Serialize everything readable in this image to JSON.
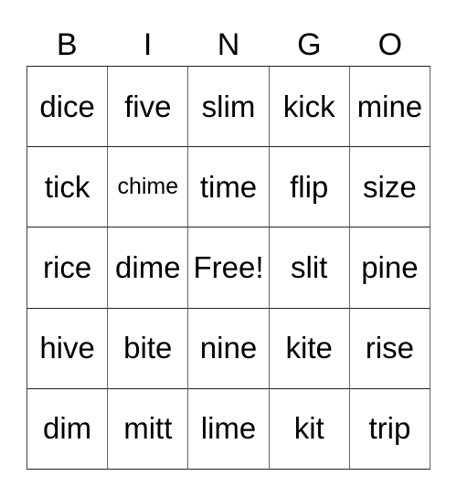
{
  "header": [
    "B",
    "I",
    "N",
    "G",
    "O"
  ],
  "rows": [
    [
      "dice",
      "five",
      "slim",
      "kick",
      "mine"
    ],
    [
      "tick",
      "chime",
      "time",
      "flip",
      "size"
    ],
    [
      "rice",
      "dime",
      "Free!",
      "slit",
      "pine"
    ],
    [
      "hive",
      "bite",
      "nine",
      "kite",
      "rise"
    ],
    [
      "dim",
      "mitt",
      "lime",
      "kit",
      "trip"
    ]
  ]
}
